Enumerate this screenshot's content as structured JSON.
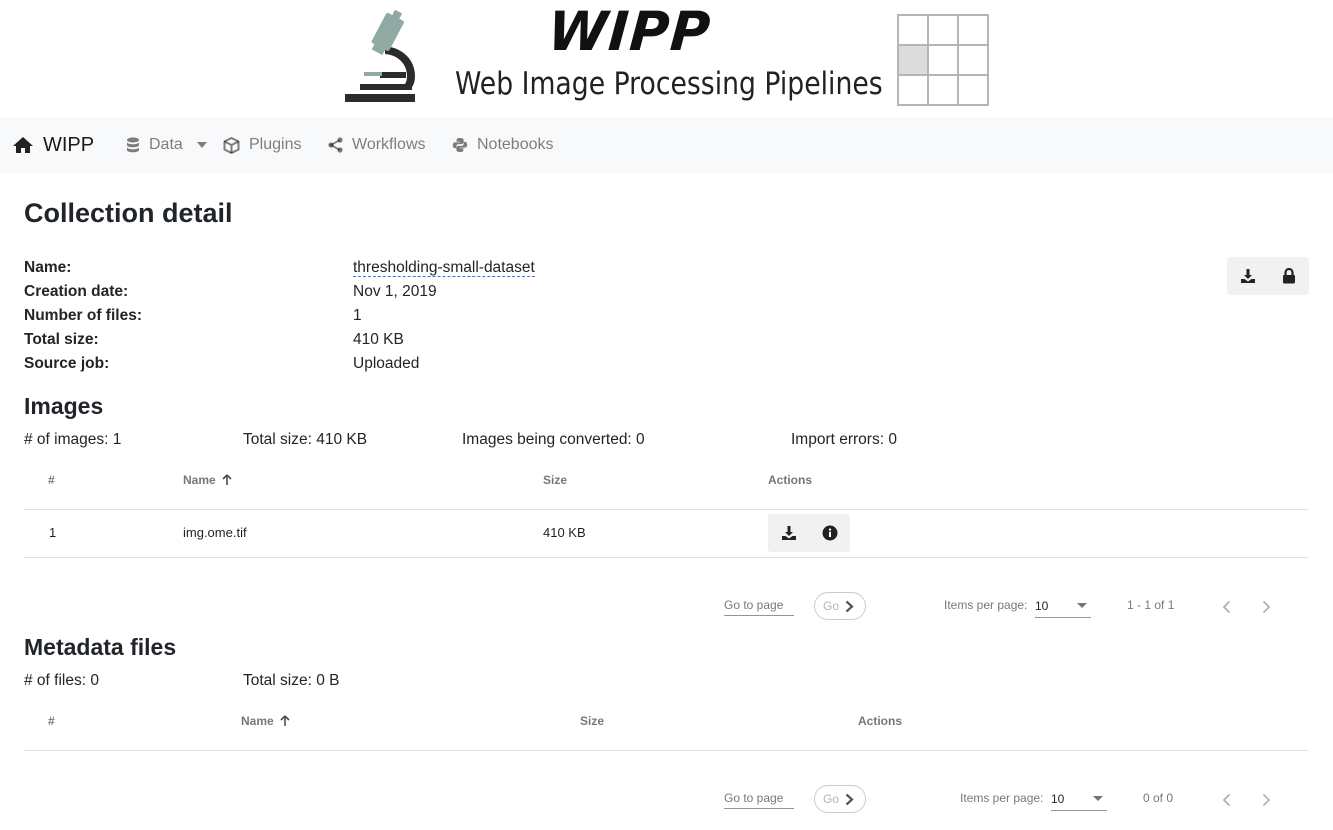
{
  "banner": {
    "title": "WIPP",
    "subtitle": "Web Image Processing Pipelines"
  },
  "navbar": {
    "brand": "WIPP",
    "items": [
      {
        "label": "Data",
        "icon": "database-icon",
        "has_dropdown": true
      },
      {
        "label": "Plugins",
        "icon": "cube-icon"
      },
      {
        "label": "Workflows",
        "icon": "share-alt-icon"
      },
      {
        "label": "Notebooks",
        "icon": "python-icon"
      }
    ]
  },
  "collection": {
    "heading": "Collection detail",
    "fields": [
      {
        "label": "Name:",
        "value": "thresholding-small-dataset"
      },
      {
        "label": "Creation date:",
        "value": "Nov 1, 2019"
      },
      {
        "label": "Number of files:",
        "value": "1"
      },
      {
        "label": "Total size:",
        "value": "410 KB"
      },
      {
        "label": "Source job:",
        "value": "Uploaded"
      }
    ],
    "actions": [
      "download-icon",
      "lock-icon"
    ]
  },
  "images": {
    "heading": "Images",
    "stats": {
      "count": "# of images: 1",
      "total_size": "Total size: 410 KB",
      "converting": "Images being converted: 0",
      "import_errors": "Import errors: 0"
    },
    "columns": [
      "#",
      "Name",
      "Size",
      "Actions"
    ],
    "rows": [
      {
        "index": "1",
        "name": "img.ome.tif",
        "size": "410 KB"
      }
    ],
    "pager": {
      "goto_label": "Go to page",
      "go_label": "Go",
      "items_per_page_label": "Items per page:",
      "items_per_page": "10",
      "range": "1 - 1 of 1"
    }
  },
  "metadata": {
    "heading": "Metadata files",
    "stats": {
      "count": "# of files: 0",
      "total_size": "Total size: 0 B"
    },
    "columns": [
      "#",
      "Name",
      "Size",
      "Actions"
    ],
    "pager": {
      "goto_label": "Go to page",
      "go_label": "Go",
      "items_per_page_label": "Items per page:",
      "items_per_page": "10",
      "range": "0 of 0"
    }
  },
  "colors": {
    "navbar_bg": "#f8f9fa",
    "link_underline": "#2c7be5",
    "icon_btn_bg": "#f1f1f1"
  }
}
